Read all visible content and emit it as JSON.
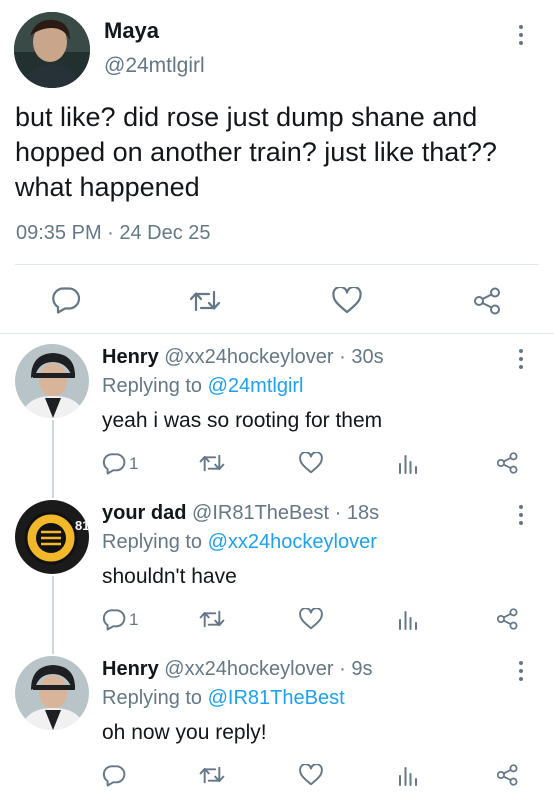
{
  "main_tweet": {
    "author_name": "Maya",
    "author_handle": "@24mtlgirl",
    "text_lines": [
      "but like? did rose just dump shane and",
      "hopped on another train? just like that??",
      "what happened"
    ],
    "timestamp": "09:35 PM · 24 Dec 25"
  },
  "replies": [
    {
      "author_name": "Henry",
      "author_handle": "@xx24hockeylover",
      "time": "· 30s",
      "replying_prefix": "Replying to",
      "replying_to": "@24mtlgirl",
      "text": "yeah i was so rooting for them",
      "reply_count": "1"
    },
    {
      "author_name": "your dad",
      "author_handle": "@IR81TheBest",
      "time": "· 18s",
      "replying_prefix": "Replying to",
      "replying_to": "@xx24hockeylover",
      "text": "shouldn't have",
      "reply_count": "1"
    },
    {
      "author_name": "Henry",
      "author_handle": "@xx24hockeylover",
      "time": "· 9s",
      "replying_prefix": "Replying to",
      "replying_to": "@IR81TheBest",
      "text": "oh now you reply!",
      "reply_count": ""
    }
  ],
  "colors": {
    "text": "#14171a",
    "secondary": "#657786",
    "link": "#1da1f2",
    "divider": "#e1e8ed"
  },
  "icons": [
    "reply-icon",
    "retweet-icon",
    "like-icon",
    "share-icon",
    "analytics-icon",
    "more-icon"
  ]
}
